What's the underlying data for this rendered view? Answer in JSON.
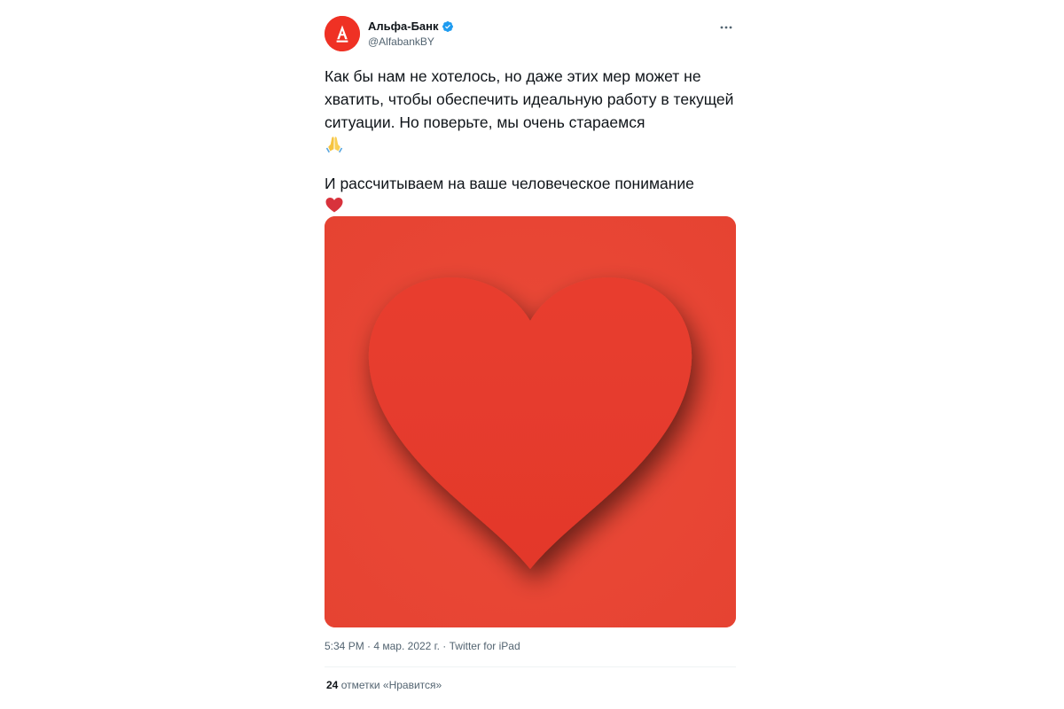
{
  "author": {
    "display_name": "Альфа-Банк",
    "handle": "@AlfabankBY",
    "avatar_icon": "alfa-logo-icon",
    "avatar_color": "#ef3124",
    "verified_icon": "verified-badge-icon",
    "verified_color": "#1d9bf0"
  },
  "menu": {
    "more_icon": "more-dots-icon"
  },
  "tweet": {
    "paragraph1": "Как бы нам не хотелось, но даже этих мер может не хватить, чтобы обеспечить идеальную работу в текущей ситуации. Но поверьте, мы очень стараемся",
    "paragraph1_emoji": "🙏",
    "paragraph2": "И рассчитываем на ваше человеческое понимание",
    "paragraph2_emoji": "❤️",
    "media_description_icon": "heart-icon",
    "media_background_color": "#e84433",
    "heart_color": "#e63a2e"
  },
  "meta": {
    "time": "5:34 PM",
    "separator": " · ",
    "date": "4 мар. 2022 г.",
    "source": "Twitter for iPad"
  },
  "stats": {
    "likes_count": "24",
    "likes_label": "отметки «Нравится»"
  }
}
